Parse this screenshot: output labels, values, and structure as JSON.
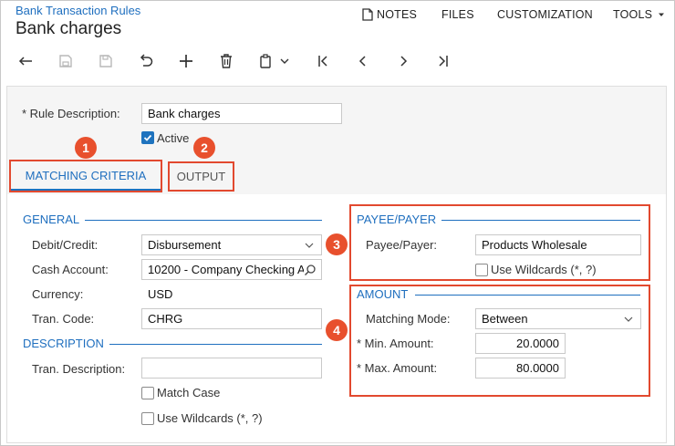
{
  "header": {
    "breadcrumb": "Bank Transaction Rules",
    "title": "Bank charges",
    "menu": {
      "notes": "NOTES",
      "files": "FILES",
      "customization": "CUSTOMIZATION",
      "tools": "TOOLS"
    }
  },
  "toolbar": {
    "icons": [
      "back-icon",
      "save-close-icon",
      "save-icon",
      "undo-icon",
      "add-icon",
      "delete-icon",
      "copy-paste-icon",
      "first-icon",
      "previous-icon",
      "next-icon",
      "last-icon"
    ]
  },
  "form": {
    "rule_description_label": "Rule Description:",
    "rule_description_value": "Bank charges",
    "active_label": "Active",
    "active_checked": true
  },
  "tabs": [
    {
      "label": "MATCHING CRITERIA",
      "active": true
    },
    {
      "label": "OUTPUT",
      "active": false
    }
  ],
  "general": {
    "title": "GENERAL",
    "debit_credit_label": "Debit/Credit:",
    "debit_credit_value": "Disbursement",
    "cash_account_label": "Cash Account:",
    "cash_account_value": "10200 - Company Checking A",
    "currency_label": "Currency:",
    "currency_value": "USD",
    "tran_code_label": "Tran. Code:",
    "tran_code_value": "CHRG"
  },
  "description": {
    "title": "DESCRIPTION",
    "tran_description_label": "Tran. Description:",
    "tran_description_value": "",
    "match_case_label": "Match Case",
    "use_wildcards_label": "Use Wildcards (*, ?)"
  },
  "payee": {
    "title": "PAYEE/PAYER",
    "payee_label": "Payee/Payer:",
    "payee_value": "Products Wholesale",
    "use_wildcards_label": "Use Wildcards (*, ?)"
  },
  "amount": {
    "title": "AMOUNT",
    "matching_mode_label": "Matching Mode:",
    "matching_mode_value": "Between",
    "min_label": "Min. Amount:",
    "min_value": "20.0000",
    "max_label": "Max. Amount:",
    "max_value": "80.0000"
  },
  "callouts": [
    "1",
    "2",
    "3",
    "4"
  ],
  "colors": {
    "accent": "#1f6fbf",
    "callout": "#e8502d"
  }
}
